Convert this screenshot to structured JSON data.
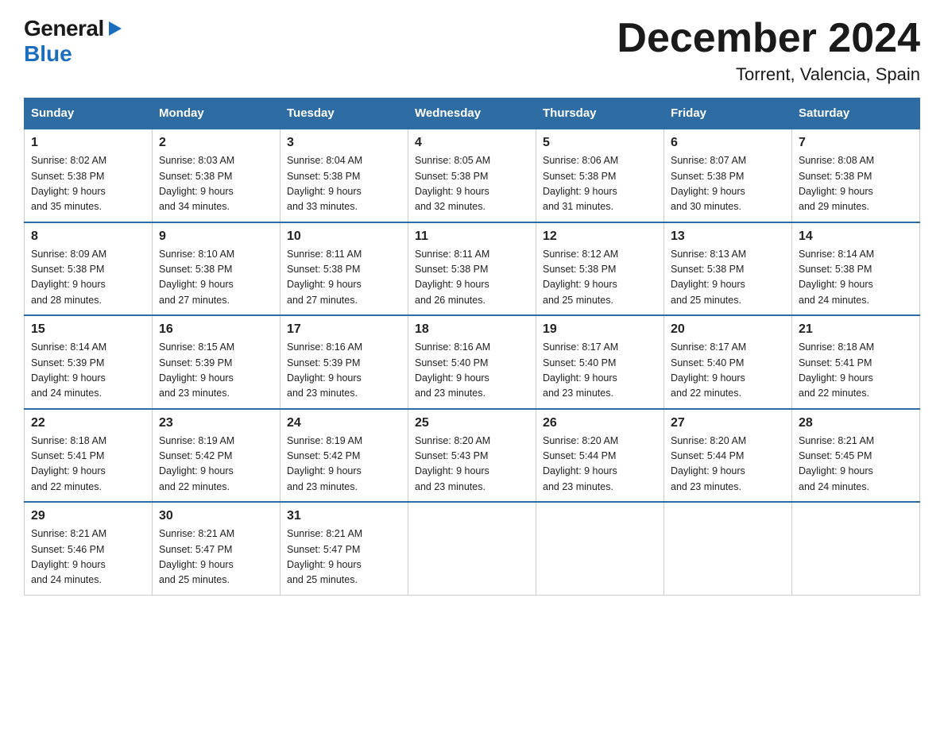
{
  "logo": {
    "general": "General",
    "blue": "Blue"
  },
  "title": "December 2024",
  "subtitle": "Torrent, Valencia, Spain",
  "days_of_week": [
    "Sunday",
    "Monday",
    "Tuesday",
    "Wednesday",
    "Thursday",
    "Friday",
    "Saturday"
  ],
  "weeks": [
    [
      {
        "num": "1",
        "sunrise": "8:02 AM",
        "sunset": "5:38 PM",
        "daylight": "9 hours and 35 minutes."
      },
      {
        "num": "2",
        "sunrise": "8:03 AM",
        "sunset": "5:38 PM",
        "daylight": "9 hours and 34 minutes."
      },
      {
        "num": "3",
        "sunrise": "8:04 AM",
        "sunset": "5:38 PM",
        "daylight": "9 hours and 33 minutes."
      },
      {
        "num": "4",
        "sunrise": "8:05 AM",
        "sunset": "5:38 PM",
        "daylight": "9 hours and 32 minutes."
      },
      {
        "num": "5",
        "sunrise": "8:06 AM",
        "sunset": "5:38 PM",
        "daylight": "9 hours and 31 minutes."
      },
      {
        "num": "6",
        "sunrise": "8:07 AM",
        "sunset": "5:38 PM",
        "daylight": "9 hours and 30 minutes."
      },
      {
        "num": "7",
        "sunrise": "8:08 AM",
        "sunset": "5:38 PM",
        "daylight": "9 hours and 29 minutes."
      }
    ],
    [
      {
        "num": "8",
        "sunrise": "8:09 AM",
        "sunset": "5:38 PM",
        "daylight": "9 hours and 28 minutes."
      },
      {
        "num": "9",
        "sunrise": "8:10 AM",
        "sunset": "5:38 PM",
        "daylight": "9 hours and 27 minutes."
      },
      {
        "num": "10",
        "sunrise": "8:11 AM",
        "sunset": "5:38 PM",
        "daylight": "9 hours and 27 minutes."
      },
      {
        "num": "11",
        "sunrise": "8:11 AM",
        "sunset": "5:38 PM",
        "daylight": "9 hours and 26 minutes."
      },
      {
        "num": "12",
        "sunrise": "8:12 AM",
        "sunset": "5:38 PM",
        "daylight": "9 hours and 25 minutes."
      },
      {
        "num": "13",
        "sunrise": "8:13 AM",
        "sunset": "5:38 PM",
        "daylight": "9 hours and 25 minutes."
      },
      {
        "num": "14",
        "sunrise": "8:14 AM",
        "sunset": "5:38 PM",
        "daylight": "9 hours and 24 minutes."
      }
    ],
    [
      {
        "num": "15",
        "sunrise": "8:14 AM",
        "sunset": "5:39 PM",
        "daylight": "9 hours and 24 minutes."
      },
      {
        "num": "16",
        "sunrise": "8:15 AM",
        "sunset": "5:39 PM",
        "daylight": "9 hours and 23 minutes."
      },
      {
        "num": "17",
        "sunrise": "8:16 AM",
        "sunset": "5:39 PM",
        "daylight": "9 hours and 23 minutes."
      },
      {
        "num": "18",
        "sunrise": "8:16 AM",
        "sunset": "5:40 PM",
        "daylight": "9 hours and 23 minutes."
      },
      {
        "num": "19",
        "sunrise": "8:17 AM",
        "sunset": "5:40 PM",
        "daylight": "9 hours and 23 minutes."
      },
      {
        "num": "20",
        "sunrise": "8:17 AM",
        "sunset": "5:40 PM",
        "daylight": "9 hours and 22 minutes."
      },
      {
        "num": "21",
        "sunrise": "8:18 AM",
        "sunset": "5:41 PM",
        "daylight": "9 hours and 22 minutes."
      }
    ],
    [
      {
        "num": "22",
        "sunrise": "8:18 AM",
        "sunset": "5:41 PM",
        "daylight": "9 hours and 22 minutes."
      },
      {
        "num": "23",
        "sunrise": "8:19 AM",
        "sunset": "5:42 PM",
        "daylight": "9 hours and 22 minutes."
      },
      {
        "num": "24",
        "sunrise": "8:19 AM",
        "sunset": "5:42 PM",
        "daylight": "9 hours and 23 minutes."
      },
      {
        "num": "25",
        "sunrise": "8:20 AM",
        "sunset": "5:43 PM",
        "daylight": "9 hours and 23 minutes."
      },
      {
        "num": "26",
        "sunrise": "8:20 AM",
        "sunset": "5:44 PM",
        "daylight": "9 hours and 23 minutes."
      },
      {
        "num": "27",
        "sunrise": "8:20 AM",
        "sunset": "5:44 PM",
        "daylight": "9 hours and 23 minutes."
      },
      {
        "num": "28",
        "sunrise": "8:21 AM",
        "sunset": "5:45 PM",
        "daylight": "9 hours and 24 minutes."
      }
    ],
    [
      {
        "num": "29",
        "sunrise": "8:21 AM",
        "sunset": "5:46 PM",
        "daylight": "9 hours and 24 minutes."
      },
      {
        "num": "30",
        "sunrise": "8:21 AM",
        "sunset": "5:47 PM",
        "daylight": "9 hours and 25 minutes."
      },
      {
        "num": "31",
        "sunrise": "8:21 AM",
        "sunset": "5:47 PM",
        "daylight": "9 hours and 25 minutes."
      },
      null,
      null,
      null,
      null
    ]
  ],
  "labels": {
    "sunrise": "Sunrise:",
    "sunset": "Sunset:",
    "daylight": "Daylight:"
  }
}
